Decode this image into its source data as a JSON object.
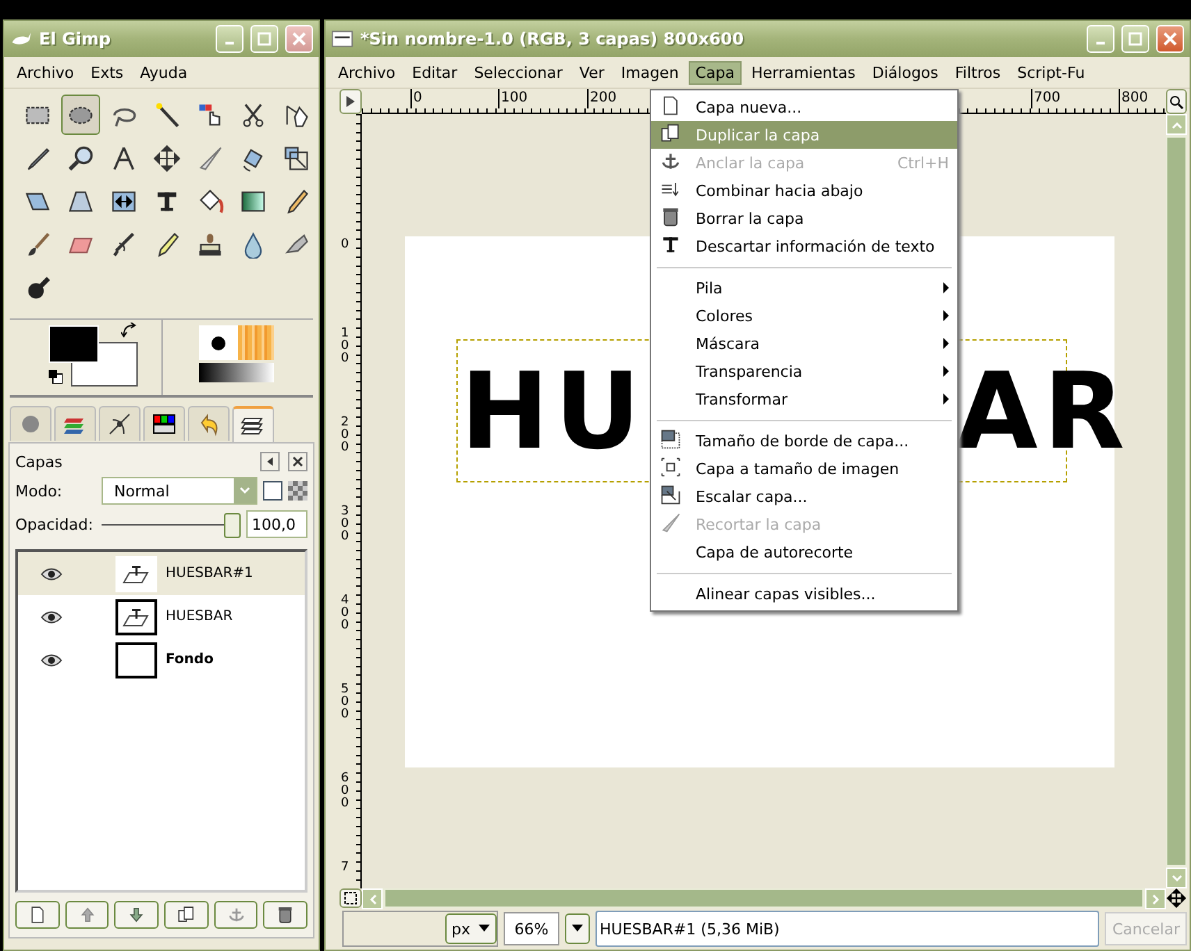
{
  "toolbox": {
    "title": "El Gimp",
    "menu": [
      {
        "label": "Archivo"
      },
      {
        "label": "Exts"
      },
      {
        "label": "Ayuda"
      }
    ],
    "tools": [
      {
        "selected": false
      },
      {
        "selected": true
      },
      {
        "selected": false
      },
      {
        "selected": false
      },
      {
        "selected": false
      },
      {
        "selected": false
      },
      {
        "selected": false
      },
      {
        "selected": false
      },
      {
        "selected": false
      },
      {
        "selected": false
      },
      {
        "selected": false
      },
      {
        "selected": false
      },
      {
        "selected": false
      },
      {
        "selected": false
      },
      {
        "selected": false
      },
      {
        "selected": false
      },
      {
        "selected": false
      },
      {
        "selected": false
      },
      {
        "selected": false
      },
      {
        "selected": false
      },
      {
        "selected": false
      },
      {
        "selected": false
      },
      {
        "selected": false
      },
      {
        "selected": false
      },
      {
        "selected": false
      },
      {
        "selected": false
      },
      {
        "selected": false
      },
      {
        "selected": false
      },
      {
        "selected": false
      }
    ],
    "layers_dock": {
      "tabs": [
        {
          "selected": false
        },
        {
          "selected": false
        },
        {
          "selected": false
        },
        {
          "selected": false
        },
        {
          "selected": false
        },
        {
          "selected": true
        }
      ],
      "title": "Capas",
      "mode_label": "Modo:",
      "mode": "Normal",
      "lock_checked": false,
      "opacity_label": "Opacidad:",
      "opacity": {
        "level": 1.0,
        "value": "100,0"
      },
      "layers": [
        {
          "name": "HUESBAR#1",
          "visible": true,
          "selected": true,
          "kind": "text",
          "bold": false
        },
        {
          "name": "HUESBAR",
          "visible": true,
          "selected": false,
          "kind": "text",
          "bold": false
        },
        {
          "name": "Fondo",
          "visible": true,
          "selected": false,
          "kind": "plain",
          "bold": true
        }
      ]
    }
  },
  "image_window": {
    "title": "*Sin nombre-1.0 (RGB, 3 capas) 800x600",
    "menu": [
      {
        "label": "Archivo",
        "selected": false
      },
      {
        "label": "Editar",
        "selected": false
      },
      {
        "label": "Seleccionar",
        "selected": false
      },
      {
        "label": "Ver",
        "selected": false
      },
      {
        "label": "Imagen",
        "selected": false
      },
      {
        "label": "Capa",
        "selected": true
      },
      {
        "label": "Herramientas",
        "selected": false
      },
      {
        "label": "Diálogos",
        "selected": false
      },
      {
        "label": "Filtros",
        "selected": false
      },
      {
        "label": "Script-Fu",
        "selected": false
      }
    ],
    "ruler_h": [
      "0",
      "100",
      "200",
      "700",
      "800"
    ],
    "ruler_v": [
      "0",
      "100",
      "200",
      "300",
      "400",
      "500",
      "600",
      "7"
    ],
    "canvas_text": [
      "HU",
      "AR"
    ],
    "layer_menu": [
      {
        "kind": "item",
        "label": "Capa nueva...",
        "selected": false,
        "disabled": false
      },
      {
        "kind": "item",
        "label": "Duplicar la capa",
        "selected": true,
        "disabled": false
      },
      {
        "kind": "item",
        "label": "Anclar la capa",
        "selected": false,
        "disabled": true,
        "shortcut": "Ctrl+H"
      },
      {
        "kind": "item",
        "label": "Combinar hacia abajo",
        "selected": false,
        "disabled": false
      },
      {
        "kind": "item",
        "label": "Borrar la capa",
        "selected": false,
        "disabled": false
      },
      {
        "kind": "item",
        "label": "Descartar información de texto",
        "selected": false,
        "disabled": false
      },
      {
        "kind": "separator"
      },
      {
        "kind": "submenu",
        "label": "Pila",
        "selected": false,
        "disabled": false
      },
      {
        "kind": "submenu",
        "label": "Colores",
        "selected": false,
        "disabled": false
      },
      {
        "kind": "submenu",
        "label": "Máscara",
        "selected": false,
        "disabled": false
      },
      {
        "kind": "submenu",
        "label": "Transparencia",
        "selected": false,
        "disabled": false
      },
      {
        "kind": "submenu",
        "label": "Transformar",
        "selected": false,
        "disabled": false
      },
      {
        "kind": "separator"
      },
      {
        "kind": "item",
        "label": "Tamaño de borde de capa...",
        "selected": false,
        "disabled": false
      },
      {
        "kind": "item",
        "label": "Capa a tamaño de imagen",
        "selected": false,
        "disabled": false
      },
      {
        "kind": "item",
        "label": "Escalar capa...",
        "selected": false,
        "disabled": false
      },
      {
        "kind": "item",
        "label": "Recortar la capa",
        "selected": false,
        "disabled": true
      },
      {
        "kind": "item",
        "label": "Capa de autorecorte",
        "selected": false,
        "disabled": false
      },
      {
        "kind": "separator"
      },
      {
        "kind": "item",
        "label": "Alinear capas visibles...",
        "selected": false,
        "disabled": false
      }
    ],
    "status": {
      "unit": "px",
      "zoom": "66%",
      "info": "HUESBAR#1 (5,36 MiB)",
      "cancel": {
        "label": "Cancelar",
        "disabled": true
      }
    }
  }
}
